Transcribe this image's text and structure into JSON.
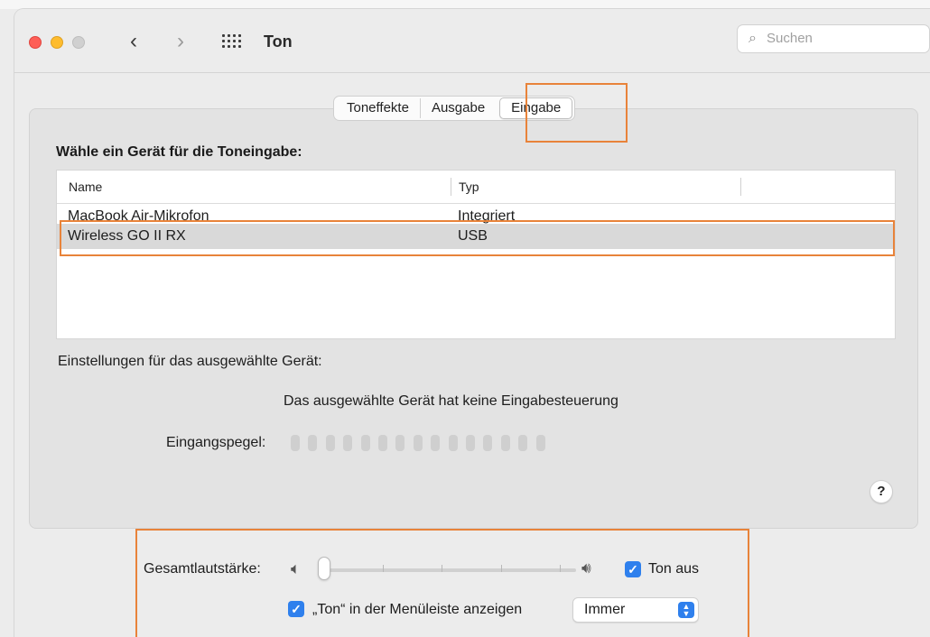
{
  "window": {
    "title": "Ton",
    "search_placeholder": "Suchen"
  },
  "tabs": [
    {
      "label": "Toneffekte"
    },
    {
      "label": "Ausgabe"
    },
    {
      "label": "Eingabe",
      "active": true
    }
  ],
  "input": {
    "heading": "Wähle ein Gerät für die Toneingabe:",
    "columns": {
      "name": "Name",
      "type": "Typ"
    },
    "devices": [
      {
        "name": "MacBook Air-Mikrofon",
        "type": "Integriert",
        "selected": false
      },
      {
        "name": "Wireless GO II RX",
        "type": "USB",
        "selected": true
      }
    ],
    "settings_label": "Einstellungen für das ausgewählte Gerät:",
    "no_control_text": "Das ausgewählte Gerät hat keine Eingabesteuerung",
    "level_label": "Eingangspegel:",
    "level_segments": 15,
    "level_active": 0
  },
  "output_volume": {
    "label": "Gesamtlautstärke:",
    "level": 0,
    "mute_label": "Ton aus",
    "mute_checked": true
  },
  "menubar": {
    "label": "„Ton“ in der Menüleiste anzeigen",
    "checked": true,
    "option": "Immer"
  },
  "help_label": "?",
  "colors": {
    "accent": "#2f80ed",
    "highlight": "#e8833a",
    "selected_row": "#d9d9d9"
  },
  "icons": [
    "back-icon",
    "forward-icon",
    "grid-icon",
    "search-icon",
    "speaker-low-icon",
    "speaker-high-icon",
    "checkbox-icon",
    "updown-icon",
    "help-icon"
  ]
}
